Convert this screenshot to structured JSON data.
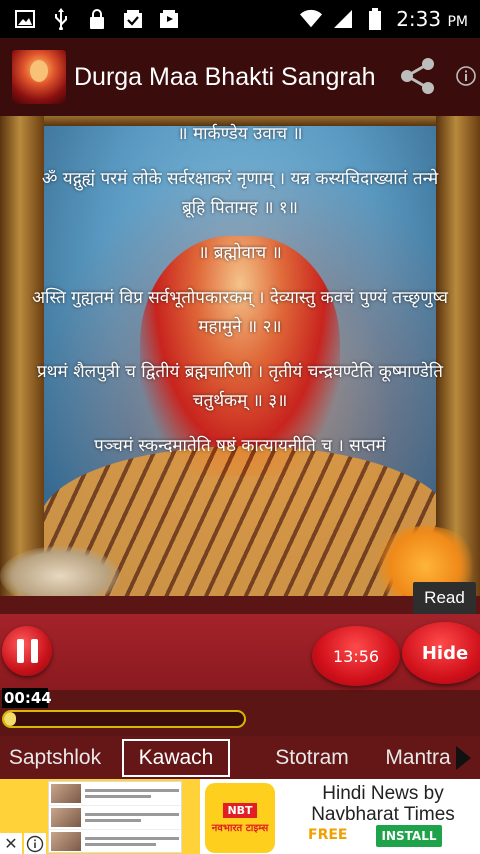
{
  "status_bar": {
    "time": "2:33",
    "ampm": "PM",
    "icons": [
      "image-icon",
      "usb-icon",
      "lock-icon",
      "download-done-icon",
      "music-download-icon",
      "wifi-icon",
      "signal-icon",
      "battery-icon"
    ]
  },
  "app_bar": {
    "title": "Durga Maa Bhakti Sangrah",
    "icons": [
      "app-logo",
      "share-icon",
      "info-icon"
    ]
  },
  "lyrics": [
    "॥ मार्कण्डेय उवाच ॥",
    "ॐ यद्गुह्यं परमं लोके सर्वरक्षाकरं नृणाम् । यन्न कस्यचिदाख्यातं तन्मे ब्रूहि पितामह ॥ १॥",
    "॥ ब्रह्मोवाच ॥",
    "अस्ति गुह्यतमं विप्र सर्वभूतोपकारकम् । देव्यास्तु कवचं पुण्यं तच्छृणुष्व महामुने ॥ २॥",
    "प्रथमं शैलपुत्री च द्वितीयं ब्रह्मचारिणी । तृतीयं चन्द्रघण्टेति कूष्माण्डेति चतुर्थकम् ॥ ३॥",
    "पञ्चमं स्कन्दमातेति षष्ठं कात्यायनीति च । सप्तमं"
  ],
  "tooltip": {
    "read": "Read"
  },
  "player": {
    "timer": "13:56",
    "hide_label": "Hide",
    "elapsed": "00:44",
    "progress_fraction": 0.05,
    "accent_color": "#d0101a",
    "progress_color": "#f2dc6a"
  },
  "tabs": {
    "items": [
      "Saptshlok",
      "Kawach",
      "Stotram",
      "Mantra"
    ],
    "selected": "Kawach"
  },
  "ad": {
    "logo_top": "NBT",
    "logo_bottom": "नवभारत टाइम्स",
    "title": "Hindi News by Navbharat Times",
    "free_label": "FREE",
    "install_label": "INSTALL",
    "close_glyph": "✕"
  }
}
